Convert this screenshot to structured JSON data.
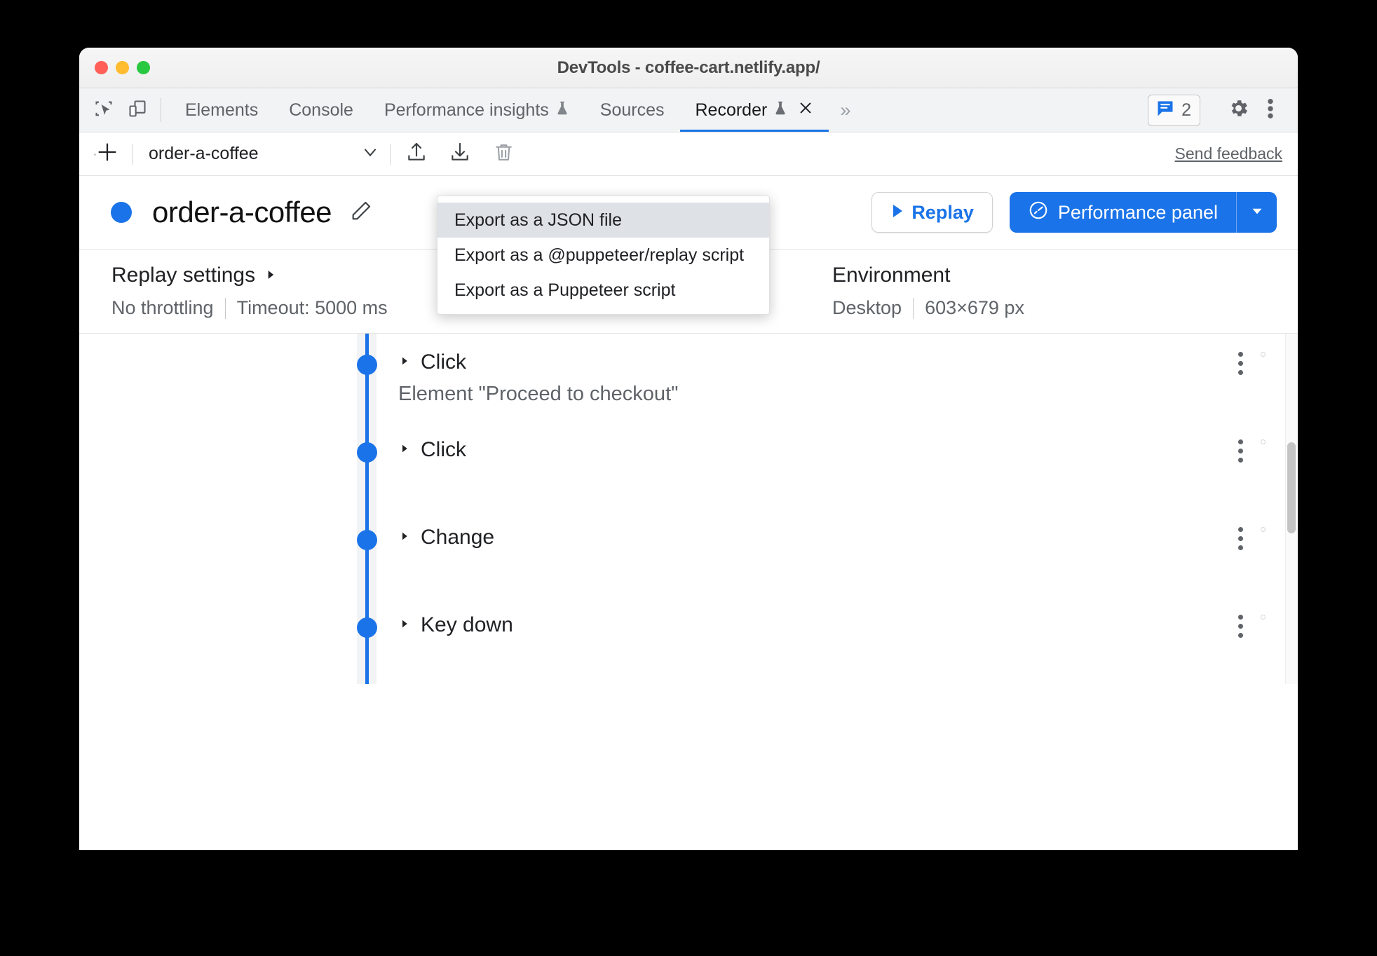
{
  "window": {
    "title": "DevTools - coffee-cart.netlify.app/",
    "traffic_lights": [
      "close",
      "minimize",
      "maximize"
    ]
  },
  "tabbar": {
    "left_icons": [
      {
        "name": "inspect-element-icon"
      },
      {
        "name": "device-toolbar-icon"
      }
    ],
    "tabs": [
      {
        "label": "Elements",
        "active": false,
        "experiment": false
      },
      {
        "label": "Console",
        "active": false,
        "experiment": false
      },
      {
        "label": "Performance insights",
        "active": false,
        "experiment": true
      },
      {
        "label": "Sources",
        "active": false,
        "experiment": false
      },
      {
        "label": "Recorder",
        "active": true,
        "experiment": true,
        "closable": true
      }
    ],
    "overflow_label": "»",
    "issues_count": "2",
    "right_icons": [
      {
        "name": "issues-icon"
      },
      {
        "name": "settings-gear-icon"
      },
      {
        "name": "more-options-icon"
      }
    ]
  },
  "toolbar": {
    "add_label": "+",
    "recording_select_value": "order-a-coffee",
    "import_label": "import-recording",
    "export_label": "export-recording",
    "delete_label": "delete-recording",
    "send_feedback_label": "Send feedback"
  },
  "export_menu": {
    "visible": true,
    "items": [
      {
        "label": "Export as a JSON file",
        "highlighted": true
      },
      {
        "label": "Export as a @puppeteer/replay script",
        "highlighted": false
      },
      {
        "label": "Export as a Puppeteer script",
        "highlighted": false
      }
    ]
  },
  "recording_header": {
    "name": "order-a-coffee",
    "edit_label": "edit-title",
    "replay_label": "Replay",
    "performance_panel_label": "Performance panel",
    "performance_caret_label": "more-replay-options"
  },
  "settings": {
    "replay": {
      "title": "Replay settings",
      "throttling": "No throttling",
      "timeout": "Timeout: 5000 ms"
    },
    "environment": {
      "title": "Environment",
      "device": "Desktop",
      "viewport": "603×679 px"
    }
  },
  "steps": [
    {
      "title": "Click",
      "detail": "Element \"Proceed to checkout\""
    },
    {
      "title": "Click",
      "detail": ""
    },
    {
      "title": "Change",
      "detail": ""
    },
    {
      "title": "Key down",
      "detail": ""
    }
  ],
  "colors": {
    "accent": "#1a73e8",
    "menu_highlight": "#dee1e6",
    "tabbar_bg": "#f1f3f4",
    "text_primary": "#202124",
    "text_secondary": "#5f6368"
  }
}
